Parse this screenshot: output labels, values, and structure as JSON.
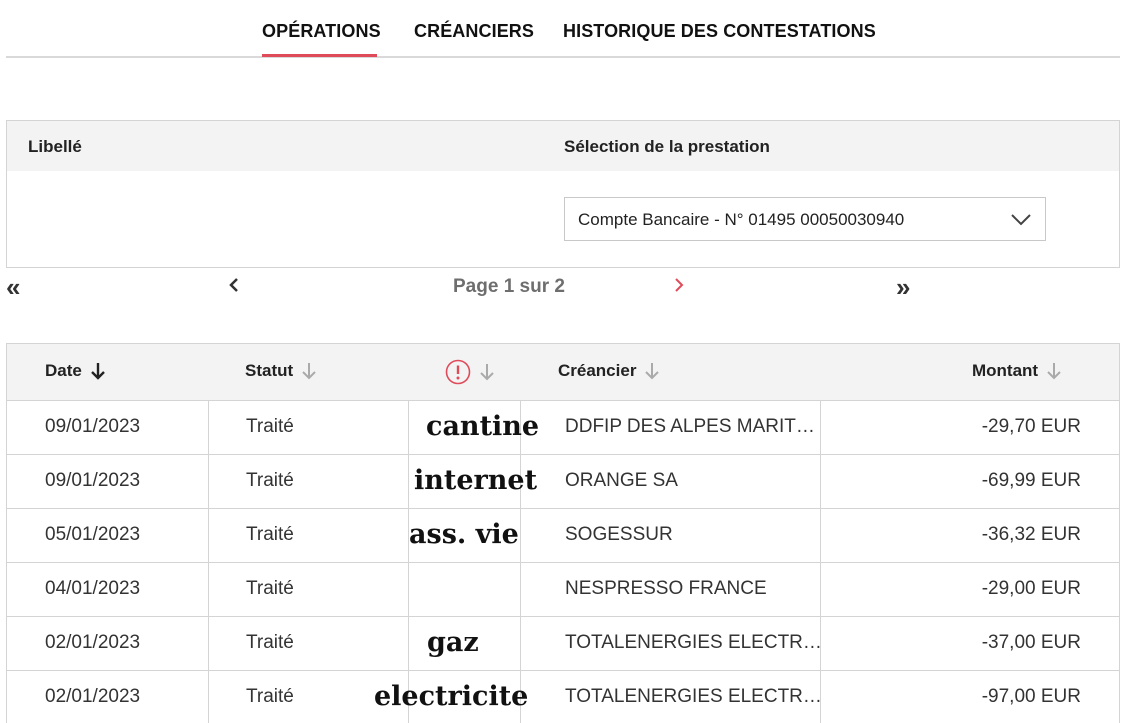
{
  "tabs": [
    {
      "label": "OPÉRATIONS",
      "active": true
    },
    {
      "label": "CRÉANCIERS",
      "active": false
    },
    {
      "label": "HISTORIQUE DES CONTESTATIONS",
      "active": false
    }
  ],
  "accent_color": "#e04b5a",
  "filters": {
    "libelle_label": "Libellé",
    "prestation_label": "Sélection de la prestation",
    "prestation_value": "Compte Bancaire - N° 01495 00050030940"
  },
  "pagination": {
    "first": "«",
    "last": "»",
    "label": "Page 1 sur 2",
    "current_page": 1,
    "total_pages": 2
  },
  "table": {
    "columns": [
      "Date",
      "Statut",
      "",
      "Créancier",
      "Montant"
    ],
    "alert_column_icon": "exclamation-circle-icon",
    "rows": [
      {
        "date": "09/01/2023",
        "status": "Traité",
        "note": "cantine",
        "creditor": "DDFIP DES ALPES MARIT…",
        "amount": "-29,70 EUR"
      },
      {
        "date": "09/01/2023",
        "status": "Traité",
        "note": "internet",
        "creditor": "ORANGE SA",
        "amount": "-69,99 EUR"
      },
      {
        "date": "05/01/2023",
        "status": "Traité",
        "note": "ass. vie",
        "creditor": "SOGESSUR",
        "amount": "-36,32 EUR"
      },
      {
        "date": "04/01/2023",
        "status": "Traité",
        "note": "",
        "creditor": "NESPRESSO FRANCE",
        "amount": "-29,00 EUR"
      },
      {
        "date": "02/01/2023",
        "status": "Traité",
        "note": "gaz",
        "creditor": "TOTALENERGIES ELECTR…",
        "amount": "-37,00 EUR"
      },
      {
        "date": "02/01/2023",
        "status": "Traité",
        "note": "electricite",
        "creditor": "TOTALENERGIES ELECTR…",
        "amount": "-97,00 EUR"
      }
    ]
  }
}
